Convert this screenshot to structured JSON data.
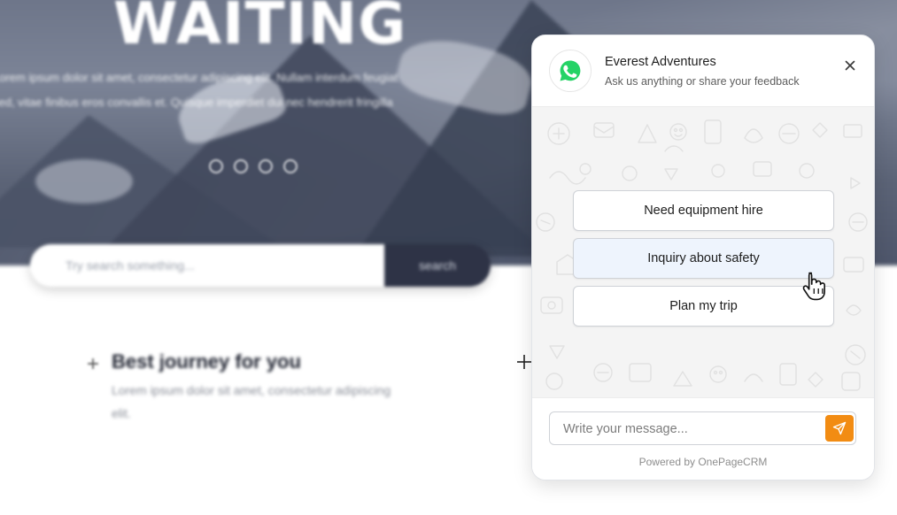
{
  "background_page": {
    "hero_title": "WAITING",
    "hero_text_line1": "Lorem ipsum dolor sit amet, consectetur adipiscing elit. Nullam interdum feugiat",
    "hero_text_line2": "sed, vitae finibus eros convallis et. Quisque imperdiet dui nec hendrerit fringilla",
    "search": {
      "placeholder": "Try search something...",
      "button_label": "search"
    },
    "feature": {
      "title": "Best journey for you",
      "description": "Lorem ipsum dolor sit amet, consectetur adipiscing elit."
    },
    "slider_dot_count": 4
  },
  "chat_widget": {
    "title": "Everest Adventures",
    "subtitle": "Ask us anything or share your feedback",
    "avatar_icon": "whatsapp-icon",
    "close_icon": "close-icon",
    "options": [
      {
        "label": "Need equipment hire"
      },
      {
        "label": "Inquiry about safety"
      },
      {
        "label": "Plan my trip"
      }
    ],
    "message_placeholder": "Write your message...",
    "send_icon": "send-icon",
    "powered_by": "Powered by OnePageCRM"
  },
  "colors": {
    "whatsapp_green": "#25D366",
    "send_button": "#f28c13",
    "option_hover_bg": "#eef4fd",
    "chat_body_bg": "#f4f4f4"
  }
}
